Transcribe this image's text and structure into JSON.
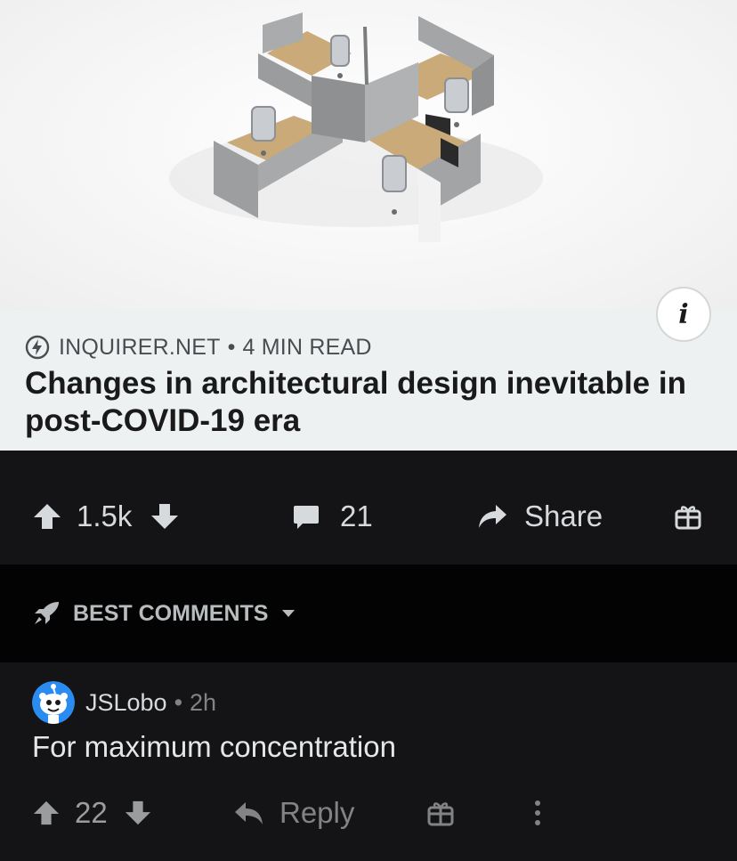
{
  "link_card": {
    "image_alt": "Office cubicle cluster with four desks and partitions",
    "info_glyph": "i",
    "source": "INQUIRER.NET",
    "separator": "•",
    "read_time": "4 MIN READ",
    "headline": "Changes in architectural design inevitable in post-COVID-19 era"
  },
  "post_actions": {
    "score": "1.5k",
    "comments": "21",
    "share_label": "Share"
  },
  "sort": {
    "label": "BEST COMMENTS"
  },
  "comment": {
    "username": "JSLobo",
    "separator": "•",
    "age": "2h",
    "body": "For maximum concentration",
    "score": "22",
    "reply_label": "Reply"
  },
  "icons": {
    "upvote": "arrow-up-icon",
    "downvote": "arrow-down-icon",
    "comments": "speech-bubble-icon",
    "share": "share-arrow-icon",
    "award": "gift-icon",
    "sort": "rocket-icon",
    "caret": "caret-down-icon",
    "reply": "reply-arrow-icon",
    "more": "more-vertical-icon",
    "source": "lightning-bolt-icon"
  },
  "colors": {
    "background": "#141416",
    "sort_bar": "#030303",
    "caption_bg": "#eef1f2",
    "text_primary": "#d7dadc",
    "text_muted": "#818384"
  }
}
